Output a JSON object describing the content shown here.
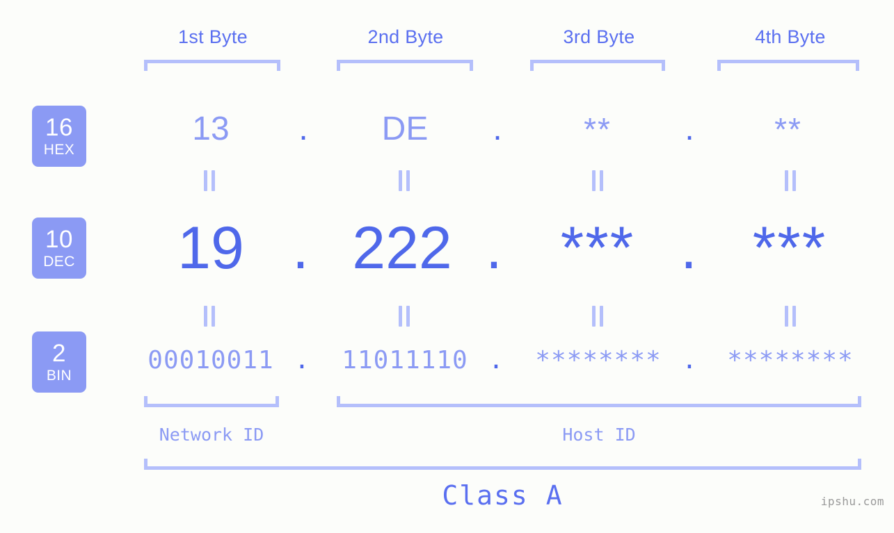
{
  "page": {
    "background_color": "#fcfdfa",
    "accent_strong": "#4f68ea",
    "accent_mid": "#5a6ff0",
    "accent_light": "#8b9af4",
    "accent_pale": "#b4bffb",
    "watermark": "ipshu.com"
  },
  "byte_headers": [
    {
      "label": "1st Byte"
    },
    {
      "label": "2nd Byte"
    },
    {
      "label": "3rd Byte"
    },
    {
      "label": "4th Byte"
    }
  ],
  "bases": [
    {
      "number": "16",
      "name": "HEX"
    },
    {
      "number": "10",
      "name": "DEC"
    },
    {
      "number": "2",
      "name": "BIN"
    }
  ],
  "rows": {
    "hex": {
      "base_number": "16",
      "base_name": "HEX",
      "values": [
        "13",
        "DE",
        "**",
        "**"
      ],
      "separators": [
        ".",
        ".",
        "."
      ]
    },
    "dec": {
      "base_number": "10",
      "base_name": "DEC",
      "values": [
        "19",
        "222",
        "***",
        "***"
      ],
      "separators": [
        ".",
        ".",
        "."
      ]
    },
    "bin": {
      "base_number": "2",
      "base_name": "BIN",
      "values": [
        "00010011",
        "11011110",
        "********",
        "********"
      ],
      "separators": [
        ".",
        ".",
        "."
      ]
    }
  },
  "connectors": {
    "glyph": "||",
    "hex_to_dec_count": 4,
    "dec_to_bin_count": 4
  },
  "footer": {
    "network_id_label": "Network ID",
    "host_id_label": "Host ID",
    "class_label": "Class A"
  }
}
